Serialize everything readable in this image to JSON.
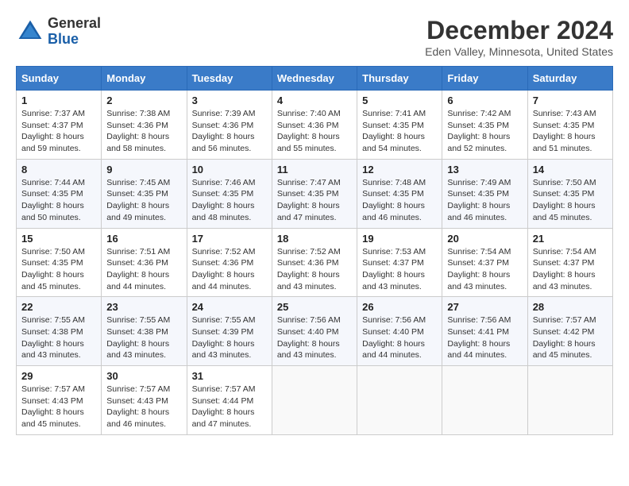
{
  "header": {
    "logo_line1": "General",
    "logo_line2": "Blue",
    "title": "December 2024",
    "subtitle": "Eden Valley, Minnesota, United States"
  },
  "calendar": {
    "days_of_week": [
      "Sunday",
      "Monday",
      "Tuesday",
      "Wednesday",
      "Thursday",
      "Friday",
      "Saturday"
    ],
    "weeks": [
      [
        {
          "day": "1",
          "sunrise": "7:37 AM",
          "sunset": "4:37 PM",
          "daylight": "8 hours and 59 minutes."
        },
        {
          "day": "2",
          "sunrise": "7:38 AM",
          "sunset": "4:36 PM",
          "daylight": "8 hours and 58 minutes."
        },
        {
          "day": "3",
          "sunrise": "7:39 AM",
          "sunset": "4:36 PM",
          "daylight": "8 hours and 56 minutes."
        },
        {
          "day": "4",
          "sunrise": "7:40 AM",
          "sunset": "4:36 PM",
          "daylight": "8 hours and 55 minutes."
        },
        {
          "day": "5",
          "sunrise": "7:41 AM",
          "sunset": "4:35 PM",
          "daylight": "8 hours and 54 minutes."
        },
        {
          "day": "6",
          "sunrise": "7:42 AM",
          "sunset": "4:35 PM",
          "daylight": "8 hours and 52 minutes."
        },
        {
          "day": "7",
          "sunrise": "7:43 AM",
          "sunset": "4:35 PM",
          "daylight": "8 hours and 51 minutes."
        }
      ],
      [
        {
          "day": "8",
          "sunrise": "7:44 AM",
          "sunset": "4:35 PM",
          "daylight": "8 hours and 50 minutes."
        },
        {
          "day": "9",
          "sunrise": "7:45 AM",
          "sunset": "4:35 PM",
          "daylight": "8 hours and 49 minutes."
        },
        {
          "day": "10",
          "sunrise": "7:46 AM",
          "sunset": "4:35 PM",
          "daylight": "8 hours and 48 minutes."
        },
        {
          "day": "11",
          "sunrise": "7:47 AM",
          "sunset": "4:35 PM",
          "daylight": "8 hours and 47 minutes."
        },
        {
          "day": "12",
          "sunrise": "7:48 AM",
          "sunset": "4:35 PM",
          "daylight": "8 hours and 46 minutes."
        },
        {
          "day": "13",
          "sunrise": "7:49 AM",
          "sunset": "4:35 PM",
          "daylight": "8 hours and 46 minutes."
        },
        {
          "day": "14",
          "sunrise": "7:50 AM",
          "sunset": "4:35 PM",
          "daylight": "8 hours and 45 minutes."
        }
      ],
      [
        {
          "day": "15",
          "sunrise": "7:50 AM",
          "sunset": "4:35 PM",
          "daylight": "8 hours and 45 minutes."
        },
        {
          "day": "16",
          "sunrise": "7:51 AM",
          "sunset": "4:36 PM",
          "daylight": "8 hours and 44 minutes."
        },
        {
          "day": "17",
          "sunrise": "7:52 AM",
          "sunset": "4:36 PM",
          "daylight": "8 hours and 44 minutes."
        },
        {
          "day": "18",
          "sunrise": "7:52 AM",
          "sunset": "4:36 PM",
          "daylight": "8 hours and 43 minutes."
        },
        {
          "day": "19",
          "sunrise": "7:53 AM",
          "sunset": "4:37 PM",
          "daylight": "8 hours and 43 minutes."
        },
        {
          "day": "20",
          "sunrise": "7:54 AM",
          "sunset": "4:37 PM",
          "daylight": "8 hours and 43 minutes."
        },
        {
          "day": "21",
          "sunrise": "7:54 AM",
          "sunset": "4:37 PM",
          "daylight": "8 hours and 43 minutes."
        }
      ],
      [
        {
          "day": "22",
          "sunrise": "7:55 AM",
          "sunset": "4:38 PM",
          "daylight": "8 hours and 43 minutes."
        },
        {
          "day": "23",
          "sunrise": "7:55 AM",
          "sunset": "4:38 PM",
          "daylight": "8 hours and 43 minutes."
        },
        {
          "day": "24",
          "sunrise": "7:55 AM",
          "sunset": "4:39 PM",
          "daylight": "8 hours and 43 minutes."
        },
        {
          "day": "25",
          "sunrise": "7:56 AM",
          "sunset": "4:40 PM",
          "daylight": "8 hours and 43 minutes."
        },
        {
          "day": "26",
          "sunrise": "7:56 AM",
          "sunset": "4:40 PM",
          "daylight": "8 hours and 44 minutes."
        },
        {
          "day": "27",
          "sunrise": "7:56 AM",
          "sunset": "4:41 PM",
          "daylight": "8 hours and 44 minutes."
        },
        {
          "day": "28",
          "sunrise": "7:57 AM",
          "sunset": "4:42 PM",
          "daylight": "8 hours and 45 minutes."
        }
      ],
      [
        {
          "day": "29",
          "sunrise": "7:57 AM",
          "sunset": "4:43 PM",
          "daylight": "8 hours and 45 minutes."
        },
        {
          "day": "30",
          "sunrise": "7:57 AM",
          "sunset": "4:43 PM",
          "daylight": "8 hours and 46 minutes."
        },
        {
          "day": "31",
          "sunrise": "7:57 AM",
          "sunset": "4:44 PM",
          "daylight": "8 hours and 47 minutes."
        },
        null,
        null,
        null,
        null
      ]
    ]
  }
}
